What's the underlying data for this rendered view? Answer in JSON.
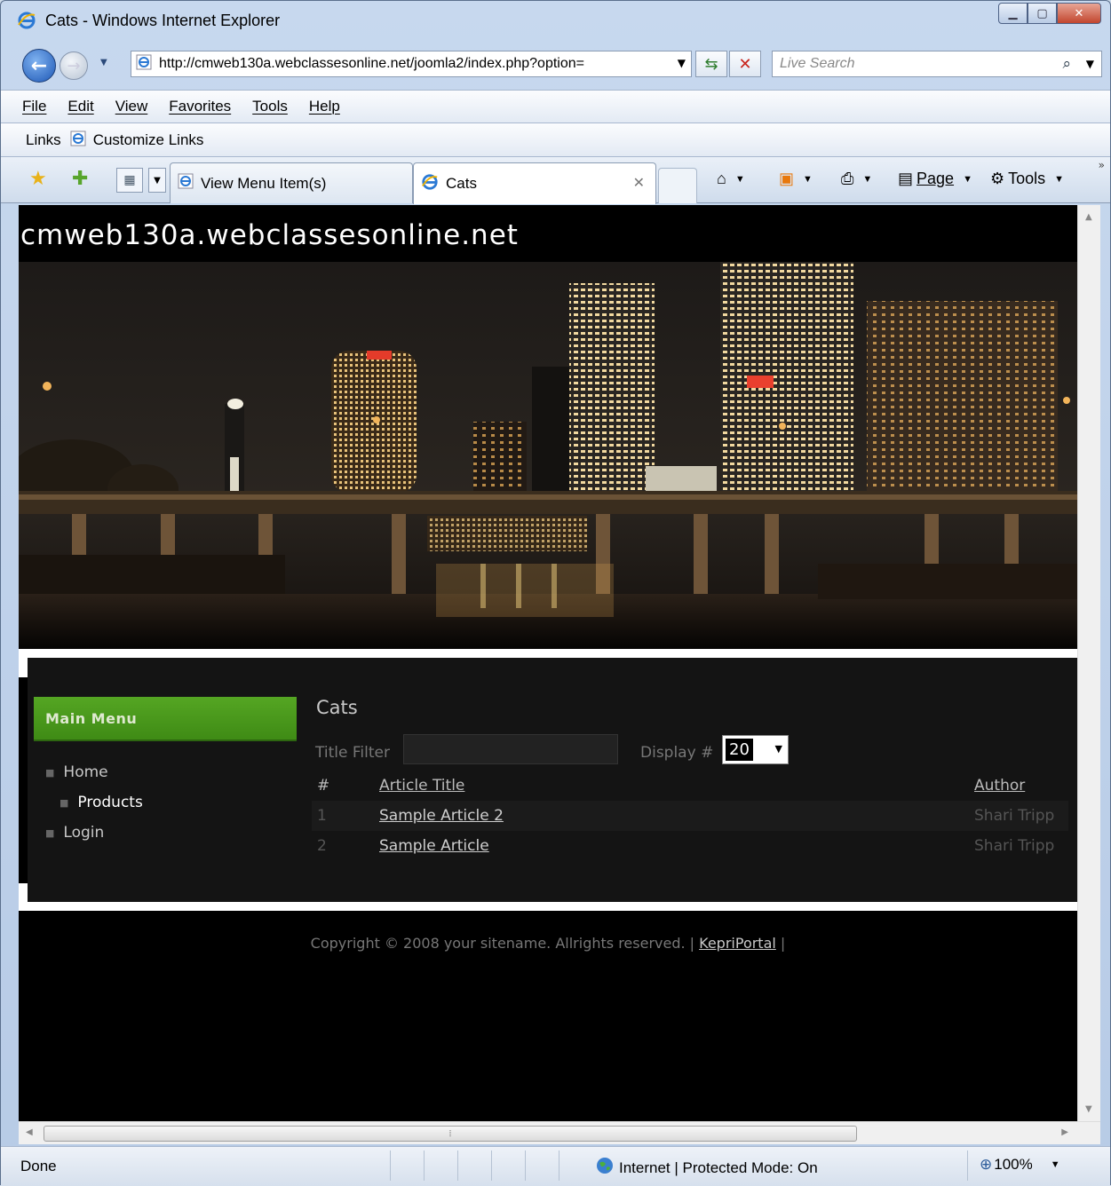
{
  "window": {
    "title": "Cats - Windows Internet Explorer"
  },
  "address_bar": {
    "url": "http://cmweb130a.webclassesonline.net/joomla2/index.php?option="
  },
  "search": {
    "placeholder": "Live Search"
  },
  "menu_bar": {
    "items": [
      "File",
      "Edit",
      "View",
      "Favorites",
      "Tools",
      "Help"
    ]
  },
  "links_bar": {
    "label": "Links",
    "items": [
      "Customize Links"
    ]
  },
  "tabs": [
    {
      "label": "View Menu Item(s)",
      "active": false
    },
    {
      "label": "Cats",
      "active": true
    }
  ],
  "command_bar": {
    "page_label": "Page",
    "tools_label": "Tools"
  },
  "page": {
    "site_title": "cmweb130a.webclassesonline.net",
    "main_menu": {
      "heading": "Main Menu",
      "items": [
        {
          "label": "Home",
          "level": 0
        },
        {
          "label": "Products",
          "level": 1
        },
        {
          "label": "Login",
          "level": 0
        }
      ]
    },
    "category": {
      "title": "Cats",
      "filter_label": "Title Filter",
      "filter_value": "",
      "display_label": "Display #",
      "display_value": "20",
      "columns": [
        "#",
        "Article Title",
        "Author"
      ],
      "rows": [
        {
          "num": "1",
          "title": "Sample Article 2",
          "author": "Shari Tripp"
        },
        {
          "num": "2",
          "title": "Sample Article",
          "author": "Shari Tripp"
        }
      ]
    },
    "footer": {
      "copyright": "Copyright © 2008 your sitename. Allrights reserved. |",
      "link": "KepriPortal",
      "trail": "|"
    }
  },
  "status_bar": {
    "text": "Done",
    "zone": "Internet | Protected Mode: On",
    "zoom": "100%"
  },
  "colors": {
    "menu_green": "#4a9a1c",
    "page_bg": "#000000",
    "content_bg": "#141414"
  }
}
